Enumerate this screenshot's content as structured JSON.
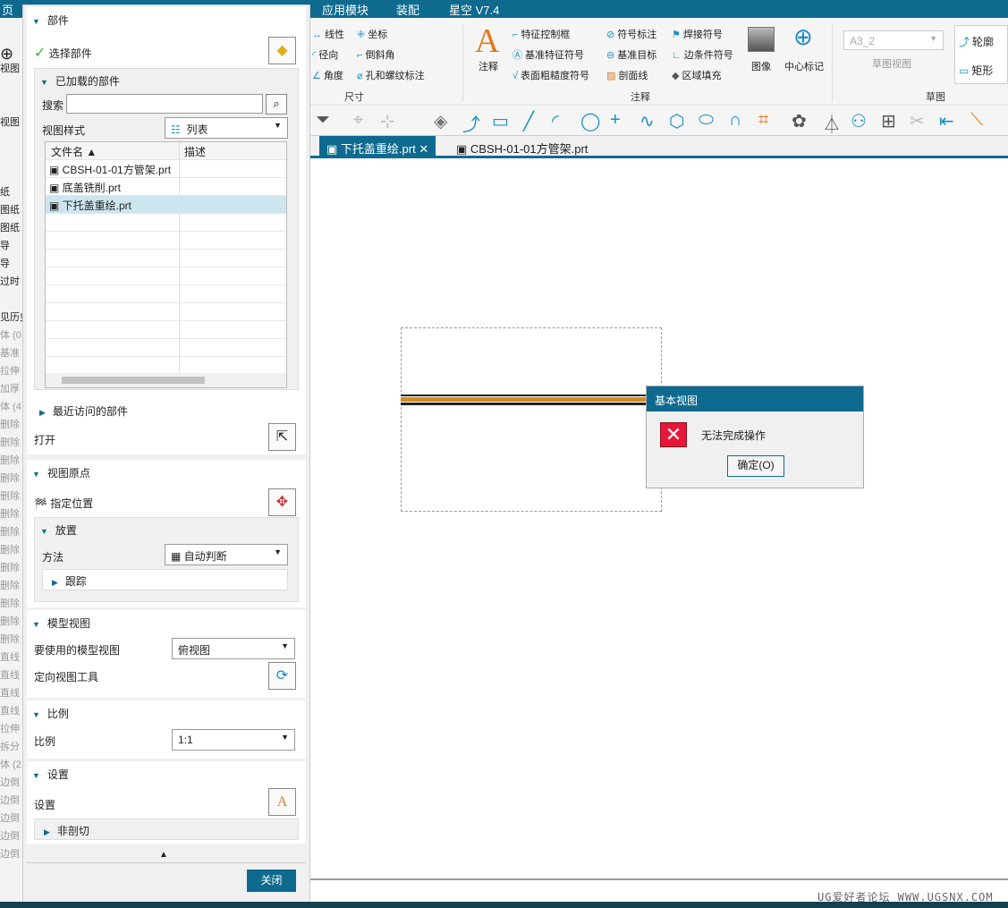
{
  "menu": {
    "left_tab": "页",
    "items": [
      "应用模块",
      "装配",
      "星空 V7.4"
    ]
  },
  "ribbon": {
    "dimension": {
      "label": "尺寸",
      "items": [
        "线性",
        "坐标",
        "径向",
        "倒斜角",
        "角度",
        "孔和螺纹标注"
      ]
    },
    "annotation": {
      "label": "注释",
      "big": "注释",
      "items": [
        "特征控制框",
        "符号标注",
        "焊接符号",
        "基准特征符号",
        "基准目标",
        "边条件符号",
        "表面粗糙度符号",
        "剖面线",
        "区域填充"
      ],
      "image": "图像",
      "center_mark": "中心标记"
    },
    "sketch_view": {
      "value": "A3_2",
      "label": "草图视图"
    },
    "sketch": {
      "label": "草图",
      "items": [
        "轮廓",
        "矩形"
      ]
    }
  },
  "tabs": [
    {
      "label": "下托盖重绘.prt",
      "active": true
    },
    {
      "label": "CBSH-01-01方管架.prt",
      "active": false
    }
  ],
  "left_strip": [
    "视图",
    "视图",
    "纸",
    "图纸",
    "图纸",
    "导",
    "导",
    "过时",
    "见历史",
    "体 (0",
    "基准",
    "拉伸",
    "加厚",
    "体 (4",
    "删除",
    "删除",
    "删除",
    "删除",
    "删除",
    "删除",
    "删除",
    "删除",
    "删除",
    "删除",
    "删除",
    "删除",
    "删除",
    "直线",
    "直线",
    "直线",
    "直线",
    "拉伸",
    "拆分",
    "体 (2",
    "边倒",
    "边倒",
    "边倒",
    "边倒",
    "边倒"
  ],
  "panel": {
    "part": {
      "title": "部件",
      "select": "选择部件",
      "loaded": {
        "title": "已加载的部件",
        "search_label": "搜索",
        "search_value": "",
        "style_label": "视图样式",
        "style_value": "列表",
        "columns": [
          "文件名",
          "描述"
        ],
        "files": [
          "CBSH-01-01方管架.prt",
          "底盖铣削.prt",
          "下托盖重绘.prt"
        ]
      },
      "recent": "最近访问的部件",
      "open": "打开"
    },
    "origin": {
      "title": "视图原点",
      "specify": "指定位置",
      "placement": "放置",
      "method_label": "方法",
      "method_value": "自动判断",
      "track": "跟踪"
    },
    "model_view": {
      "title": "模型视图",
      "use_label": "要使用的模型视图",
      "use_value": "俯视图",
      "orient": "定向视图工具"
    },
    "scale": {
      "title": "比例",
      "label": "比例",
      "value": "1:1"
    },
    "settings": {
      "title": "设置",
      "label": "设置",
      "section": "非剖切"
    },
    "close": "关闭"
  },
  "dialog": {
    "title": "基本视图",
    "message": "无法完成操作",
    "ok": "确定(O)"
  },
  "watermark": "UG爱好者论坛 WWW.UGSNX.COM"
}
